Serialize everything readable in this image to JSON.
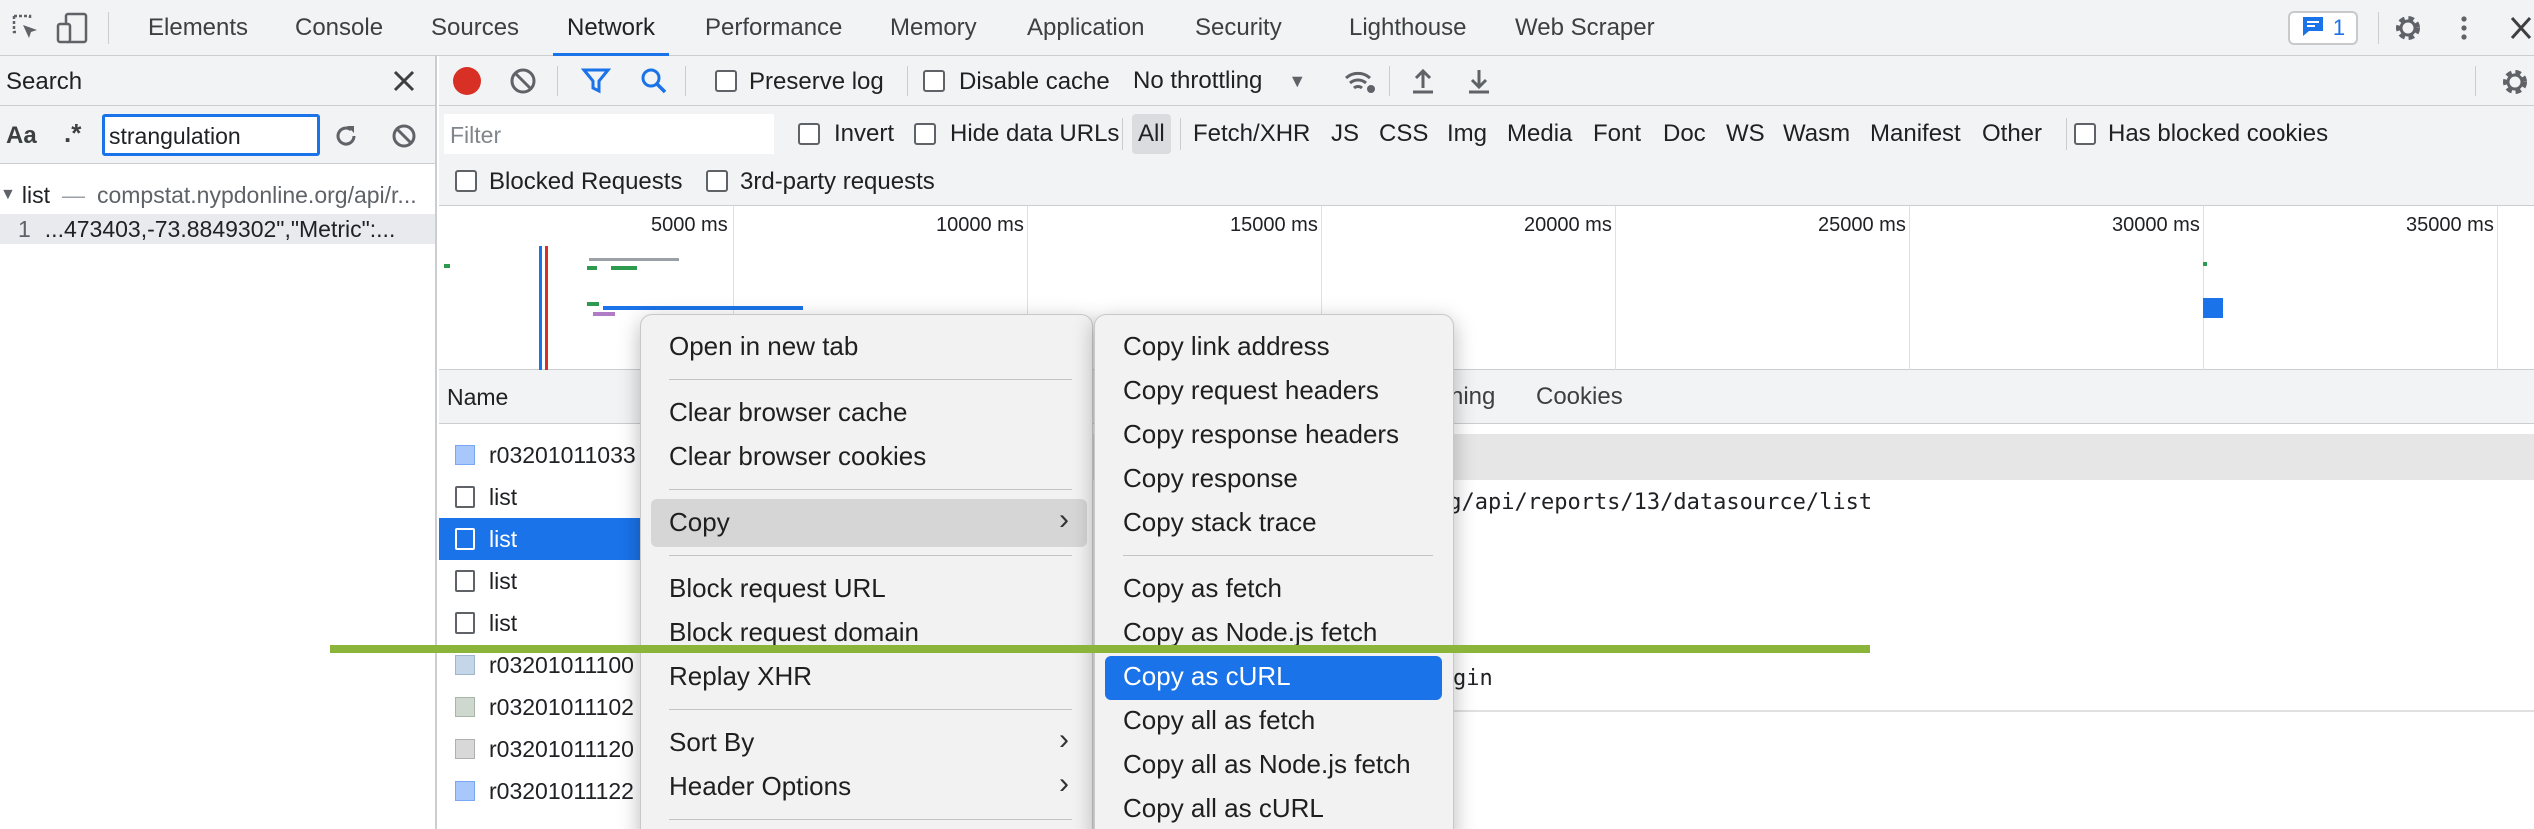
{
  "tabs": {
    "elements": "Elements",
    "console": "Console",
    "sources": "Sources",
    "network": "Network",
    "performance": "Performance",
    "memory": "Memory",
    "application": "Application",
    "security": "Security",
    "lighthouse": "Lighthouse",
    "web_scraper": "Web Scraper"
  },
  "issues_badge": {
    "count": "1"
  },
  "search_panel": {
    "title": "Search",
    "aa_label": "Aa",
    "regex_label": ".*",
    "query": "strangulation",
    "result_file": "list",
    "result_separator": "—",
    "result_url": "compstat.nypdonline.org/api/r...",
    "result_line_num": "1",
    "result_line_text": "...473403,-73.8849302\",\"Metric\":..."
  },
  "toolbar": {
    "preserve_log": "Preserve log",
    "disable_cache": "Disable cache",
    "throttling": "No throttling"
  },
  "filter_bar": {
    "placeholder": "Filter",
    "invert": "Invert",
    "hide_data_urls": "Hide data URLs",
    "types": [
      "All",
      "Fetch/XHR",
      "JS",
      "CSS",
      "Img",
      "Media",
      "Font",
      "Doc",
      "WS",
      "Wasm",
      "Manifest",
      "Other"
    ],
    "has_blocked_cookies": "Has blocked cookies",
    "blocked_requests": "Blocked Requests",
    "third_party": "3rd-party requests"
  },
  "timeline": {
    "ticks": [
      "5000 ms",
      "10000 ms",
      "15000 ms",
      "20000 ms",
      "25000 ms",
      "30000 ms",
      "35000 ms"
    ]
  },
  "request_list": {
    "name_header": "Name",
    "rows": [
      "r03201011033",
      "list",
      "list",
      "list",
      "list",
      "r03201011100",
      "r03201011102",
      "r03201011120",
      "r03201011122"
    ]
  },
  "details": {
    "tab_timing_partial": "ning",
    "tab_cookies": "Cookies",
    "url_partial": "rg/api/reports/13/datasource/list",
    "origin_partial": "gin"
  },
  "context_menu": {
    "open_new_tab": "Open in new tab",
    "clear_cache": "Clear browser cache",
    "clear_cookies": "Clear browser cookies",
    "copy": "Copy",
    "block_url": "Block request URL",
    "block_domain": "Block request domain",
    "replay": "Replay XHR",
    "sort_by": "Sort By",
    "header_options": "Header Options"
  },
  "copy_submenu": {
    "link_address": "Copy link address",
    "request_headers": "Copy request headers",
    "response_headers": "Copy response headers",
    "response": "Copy response",
    "stack_trace": "Copy stack trace",
    "as_fetch": "Copy as fetch",
    "as_node_fetch": "Copy as Node.js fetch",
    "as_curl": "Copy as cURL",
    "all_as_fetch": "Copy all as fetch",
    "all_as_node_fetch": "Copy all as Node.js fetch",
    "all_as_curl": "Copy all as cURL"
  },
  "colors": {
    "accent": "#1a73e8",
    "selected_row": "#1a73e8",
    "record": "#d93025",
    "annotation_line": "#8bb43a"
  }
}
